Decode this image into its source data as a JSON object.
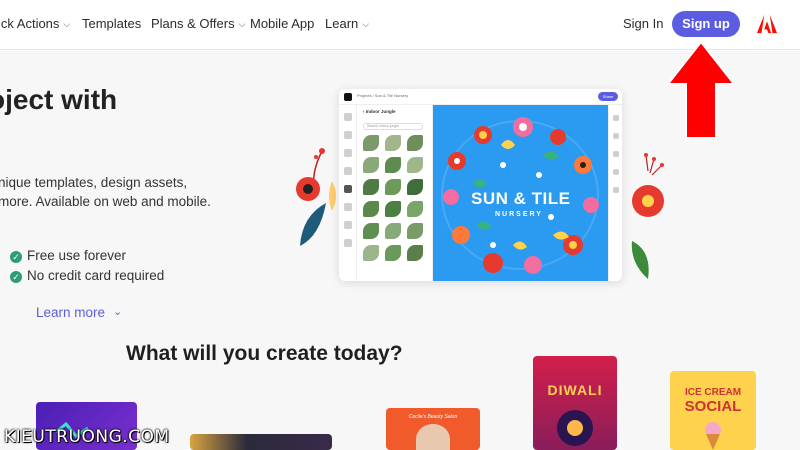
{
  "nav": {
    "items": [
      {
        "label": "ick Actions",
        "has_dropdown": true
      },
      {
        "label": "Templates",
        "has_dropdown": false
      },
      {
        "label": "Plans & Offers",
        "has_dropdown": true
      },
      {
        "label": "Mobile App",
        "has_dropdown": false
      },
      {
        "label": "Learn",
        "has_dropdown": true
      }
    ],
    "sign_in": "Sign In",
    "sign_up": "Sign up",
    "brand_color": "#5c5ce0",
    "logo_icon": "adobe-logo-icon"
  },
  "hero": {
    "headline": "oject with",
    "headline_line2": ".",
    "description_lines": [
      "nique templates, design assets,",
      "more. Available on web and mobile."
    ],
    "benefits": [
      "Free use forever",
      "No credit card required"
    ],
    "learn_more": "Learn more",
    "section_title": "What will you create today?"
  },
  "mockup": {
    "breadcrumb": "Projects  /  Sun & Tile Nursery",
    "share_label": "Share",
    "panel_title": "‹ Indoor Jungle",
    "search_placeholder": "Search indoor jungle",
    "canvas_title": "SUN & TILE",
    "canvas_subtitle": "NURSERY",
    "canvas_color": "#2a9bf0"
  },
  "cards": {
    "diwali_label": "DIWALI",
    "ice_cream_line1": "ICE CREAM",
    "ice_cream_line2": "SOCIAL",
    "beauty_label": "Cecile's Beauty Salon"
  },
  "annotation": {
    "arrow_color": "#ff0000"
  },
  "watermark": "KIEUTRUONG.COM"
}
